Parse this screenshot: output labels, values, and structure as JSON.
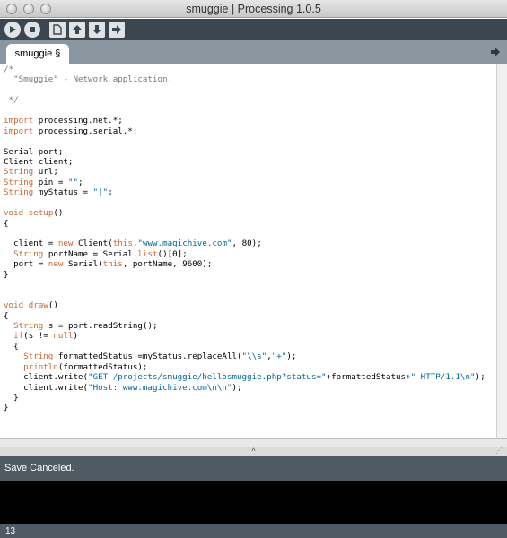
{
  "window": {
    "title": "smuggie | Processing 1.0.5"
  },
  "toolbar": {
    "buttons": [
      {
        "name": "run-button",
        "icon": "play-icon"
      },
      {
        "name": "stop-button",
        "icon": "stop-icon"
      },
      {
        "name": "new-button",
        "icon": "new-file-icon"
      },
      {
        "name": "open-button",
        "icon": "open-up-arrow-icon"
      },
      {
        "name": "save-button",
        "icon": "save-down-arrow-icon"
      },
      {
        "name": "export-button",
        "icon": "export-right-arrow-icon"
      }
    ]
  },
  "tabs": {
    "active_label": "smuggie §",
    "menu_icon": "right-arrow-icon"
  },
  "editor": {
    "lines": [
      [
        {
          "t": "/*",
          "c": "cm"
        }
      ],
      [
        {
          "t": "  \"Smuggie\" - Network application.",
          "c": "cm"
        }
      ],
      [
        {
          "t": "",
          "c": ""
        }
      ],
      [
        {
          "t": " */",
          "c": "cm"
        }
      ],
      [
        {
          "t": "",
          "c": ""
        }
      ],
      [
        {
          "t": "import",
          "c": "kw"
        },
        {
          "t": " processing.net.*;",
          "c": ""
        }
      ],
      [
        {
          "t": "import",
          "c": "kw"
        },
        {
          "t": " processing.serial.*;",
          "c": ""
        }
      ],
      [
        {
          "t": "",
          "c": ""
        }
      ],
      [
        {
          "t": "Serial port;",
          "c": ""
        }
      ],
      [
        {
          "t": "Client client;",
          "c": ""
        }
      ],
      [
        {
          "t": "String",
          "c": "ty"
        },
        {
          "t": " url;",
          "c": ""
        }
      ],
      [
        {
          "t": "String",
          "c": "ty"
        },
        {
          "t": " pin = ",
          "c": ""
        },
        {
          "t": "\"\"",
          "c": "str"
        },
        {
          "t": ";",
          "c": ""
        }
      ],
      [
        {
          "t": "String",
          "c": "ty"
        },
        {
          "t": " myStatus = ",
          "c": ""
        },
        {
          "t": "\"|\"",
          "c": "str"
        },
        {
          "t": ";",
          "c": ""
        }
      ],
      [
        {
          "t": "",
          "c": ""
        }
      ],
      [
        {
          "t": "void",
          "c": "kw"
        },
        {
          "t": " ",
          "c": ""
        },
        {
          "t": "setup",
          "c": "fn"
        },
        {
          "t": "()",
          "c": ""
        }
      ],
      [
        {
          "t": "{",
          "c": ""
        }
      ],
      [
        {
          "t": "",
          "c": ""
        }
      ],
      [
        {
          "t": "  client = ",
          "c": ""
        },
        {
          "t": "new",
          "c": "kw"
        },
        {
          "t": " Client(",
          "c": ""
        },
        {
          "t": "this",
          "c": "kw"
        },
        {
          "t": ",",
          "c": ""
        },
        {
          "t": "\"www.magichive.com\"",
          "c": "str"
        },
        {
          "t": ", 80);",
          "c": ""
        }
      ],
      [
        {
          "t": "  ",
          "c": ""
        },
        {
          "t": "String",
          "c": "ty"
        },
        {
          "t": " portName = Serial.",
          "c": ""
        },
        {
          "t": "list",
          "c": "fn"
        },
        {
          "t": "()[0];",
          "c": ""
        }
      ],
      [
        {
          "t": "  port = ",
          "c": ""
        },
        {
          "t": "new",
          "c": "kw"
        },
        {
          "t": " Serial(",
          "c": ""
        },
        {
          "t": "this",
          "c": "kw"
        },
        {
          "t": ", portName, 9600);",
          "c": ""
        }
      ],
      [
        {
          "t": "}",
          "c": ""
        }
      ],
      [
        {
          "t": "",
          "c": ""
        }
      ],
      [
        {
          "t": "",
          "c": ""
        }
      ],
      [
        {
          "t": "void",
          "c": "kw"
        },
        {
          "t": " ",
          "c": ""
        },
        {
          "t": "draw",
          "c": "fn"
        },
        {
          "t": "()",
          "c": ""
        }
      ],
      [
        {
          "t": "{",
          "c": ""
        }
      ],
      [
        {
          "t": "  ",
          "c": ""
        },
        {
          "t": "String",
          "c": "ty"
        },
        {
          "t": " s = port.readString();",
          "c": ""
        }
      ],
      [
        {
          "t": "  ",
          "c": ""
        },
        {
          "t": "if",
          "c": "kw"
        },
        {
          "t": "(s != ",
          "c": ""
        },
        {
          "t": "null",
          "c": "kw"
        },
        {
          "t": ")",
          "c": ""
        }
      ],
      [
        {
          "t": "  {",
          "c": ""
        }
      ],
      [
        {
          "t": "    ",
          "c": ""
        },
        {
          "t": "String",
          "c": "ty"
        },
        {
          "t": " formattedStatus =myStatus.replaceAll(",
          "c": ""
        },
        {
          "t": "\"\\\\s\"",
          "c": "str"
        },
        {
          "t": ",",
          "c": ""
        },
        {
          "t": "\"+\"",
          "c": "str"
        },
        {
          "t": ");",
          "c": ""
        }
      ],
      [
        {
          "t": "    ",
          "c": ""
        },
        {
          "t": "println",
          "c": "fn"
        },
        {
          "t": "(formattedStatus);",
          "c": ""
        }
      ],
      [
        {
          "t": "    client.write(",
          "c": ""
        },
        {
          "t": "\"GET /projects/smuggie/hellosmuggie.php?status=\"",
          "c": "str"
        },
        {
          "t": "+formattedStatus+",
          "c": ""
        },
        {
          "t": "\" HTTP/1.1\\n\"",
          "c": "str"
        },
        {
          "t": ");",
          "c": ""
        }
      ],
      [
        {
          "t": "    client.write(",
          "c": ""
        },
        {
          "t": "\"Host: www.magichive.com\\n\\n\"",
          "c": "str"
        },
        {
          "t": ");",
          "c": ""
        }
      ],
      [
        {
          "t": "  }",
          "c": ""
        }
      ],
      [
        {
          "t": "}",
          "c": ""
        }
      ]
    ]
  },
  "divider": {
    "arrow": "^"
  },
  "status": {
    "message": "Save Canceled."
  },
  "linebar": {
    "line_number": "13"
  }
}
